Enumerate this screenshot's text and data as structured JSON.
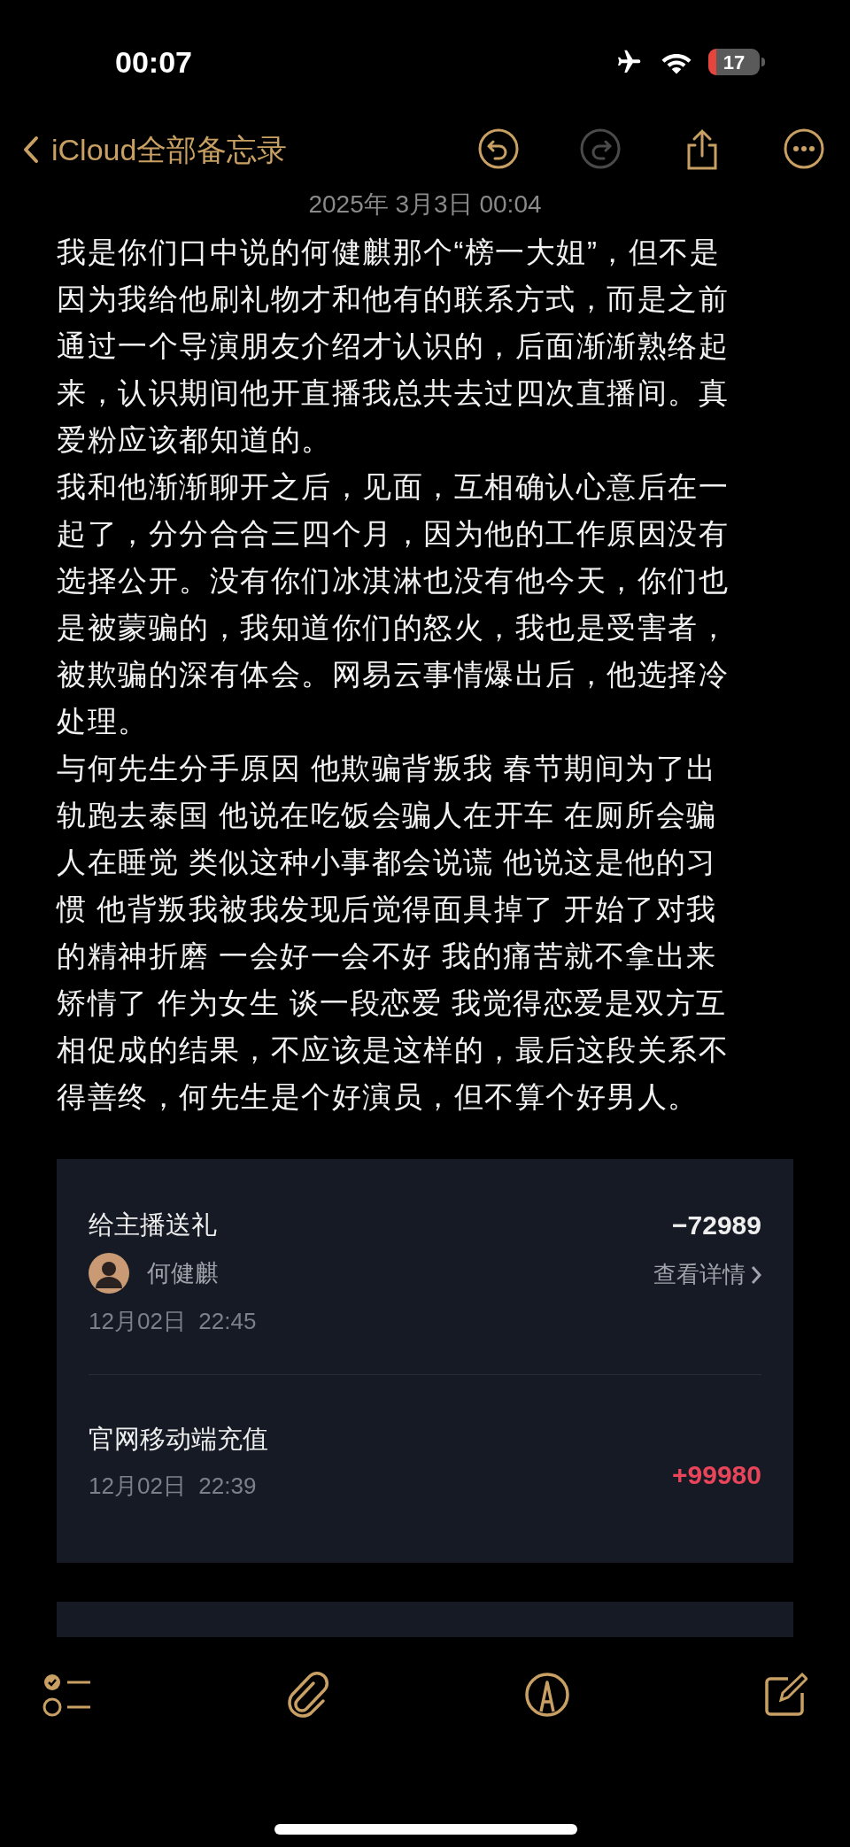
{
  "status_bar": {
    "time": "00:07",
    "battery": "17"
  },
  "nav": {
    "back_label": "iCloud全部备忘录",
    "actions": [
      {
        "kind": "undo",
        "disabled": false
      },
      {
        "kind": "redo",
        "disabled": true
      },
      {
        "kind": "share",
        "disabled": false
      },
      {
        "kind": "more",
        "disabled": false
      }
    ]
  },
  "note": {
    "date": "2025年 3月3日 00:04",
    "paragraphs": [
      "我是你们口中说的何健麒那个“榜一大姐”，但不是因为我给他刷礼物才和他有的联系方式，而是之前通过一个导演朋友介绍才认识的，后面渐渐熟络起来，认识期间他开直播我总共去过四次直播间。真爱粉应该都知道的。",
      "我和他渐渐聊开之后，见面，互相确认心意后在一起了，分分合合三四个月，因为他的工作原因没有选择公开。没有你们冰淇淋也没有他今天，你们也是被蒙骗的，我知道你们的怒火，我也是受害者，被欺骗的深有体会。网易云事情爆出后，他选择冷处理。",
      "与何先生分手原因 他欺骗背叛我 春节期间为了出轨跑去泰国 他说在吃饭会骗人在开车 在厕所会骗人在睡觉 类似这种小事都会说谎 他说这是他的习惯 他背叛我被我发现后觉得面具掉了 开始了对我的精神折磨 一会好一会不好 我的痛苦就不拿出来矫情了 作为女生 谈一段恋爱 我觉得恋爱是双方互相促成的结果，不应该是这样的，最后这段关系不得善终，何先生是个好演员，但不算个好男人。"
    ]
  },
  "transactions": [
    {
      "kind": "expense",
      "title": "给主播送礼",
      "amount": "−72989",
      "counterparty": "何健麒",
      "detail_link": "查看详情",
      "time": "12月02日  22:45"
    },
    {
      "kind": "income",
      "title": "官网移动端充值",
      "amount": "+99980",
      "time": "12月02日  22:39"
    }
  ]
}
